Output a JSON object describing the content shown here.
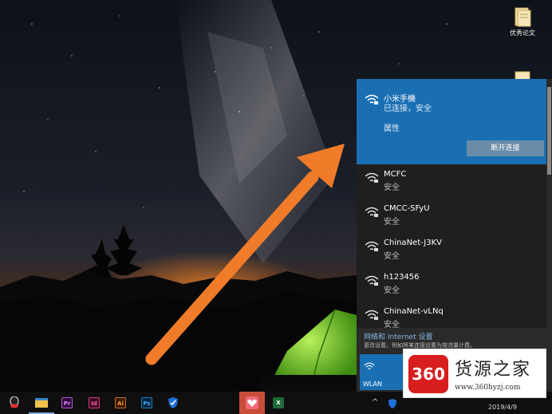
{
  "desktop": {
    "icons": [
      {
        "label": "优秀论文",
        "icon": "folder-icon"
      },
      {
        "label": "",
        "icon": "folder-icon"
      }
    ]
  },
  "wifi_panel": {
    "connected": {
      "name": "小米手機",
      "status": "已连接，安全",
      "properties_link": "属性",
      "disconnect_label": "断开连接"
    },
    "networks": [
      {
        "name": "MCFC",
        "status": "安全"
      },
      {
        "name": "CMCC-SFyU",
        "status": "安全"
      },
      {
        "name": "ChinaNet-J3KV",
        "status": "安全"
      },
      {
        "name": "h123456",
        "status": "安全"
      },
      {
        "name": "ChinaNet-vLNq",
        "status": "安全"
      }
    ],
    "settings_link": "网络和 Internet 设置",
    "settings_desc": "更改设置，例如将某连接设置为按流量计费。",
    "wlan_tile": "WLAN"
  },
  "taskbar": {
    "apps": [
      {
        "icon": "qq-icon",
        "label": ""
      },
      {
        "icon": "file-explorer-icon",
        "label": ""
      },
      {
        "icon": "premiere-icon",
        "label": "Pr"
      },
      {
        "icon": "indesign-icon",
        "label": "Id"
      },
      {
        "icon": "illustrator-icon",
        "label": "Ai"
      },
      {
        "icon": "photoshop-icon",
        "label": "Ps"
      },
      {
        "icon": "shield-icon",
        "label": ""
      },
      {
        "icon": "heart-app-icon",
        "label": ""
      },
      {
        "icon": "excel-icon",
        "label": "X"
      }
    ],
    "clock_date": "2019/4/9"
  },
  "watermark": {
    "logo": "360",
    "title": "货源之家",
    "url": "www.360hyzj.com"
  },
  "colors": {
    "accent": "#1a6fb3",
    "arrow": "#f07c2a",
    "flyout_bg": "#1f1f1f"
  }
}
